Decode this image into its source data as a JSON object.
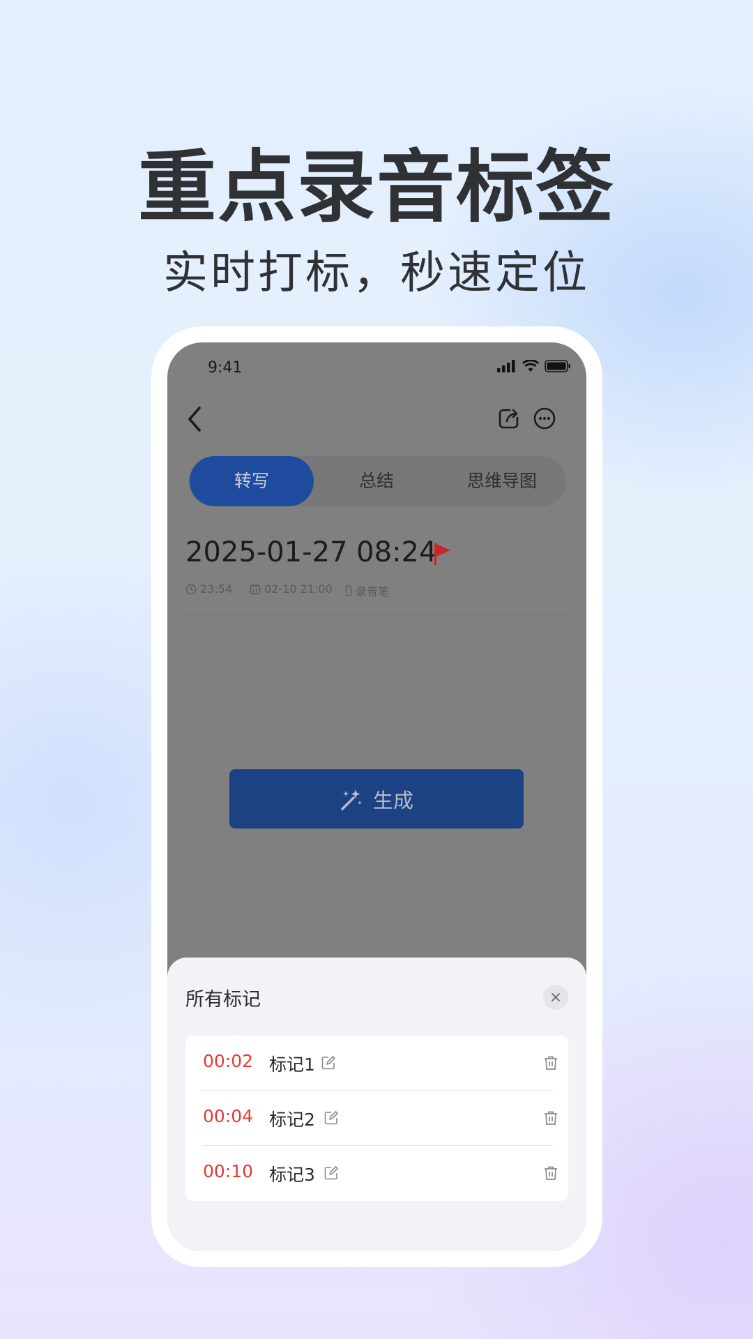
{
  "hero": {
    "title": "重点录音标签",
    "subtitle": "实时打标，秒速定位"
  },
  "status_bar": {
    "time": "9:41",
    "icons": [
      "signal-icon",
      "wifi-icon",
      "battery-icon"
    ]
  },
  "nav": {
    "icons": [
      "back-icon",
      "share-icon",
      "more-icon"
    ]
  },
  "tabs": [
    {
      "label": "转写",
      "active": true
    },
    {
      "label": "总结",
      "active": false
    },
    {
      "label": "思维导图",
      "active": false
    }
  ],
  "recording": {
    "title": "2025-01-27 08:24",
    "flag_color": "#e53935",
    "duration": "23:54",
    "date": "02-10 21:00",
    "device": "录音笔"
  },
  "generate_button": {
    "label": "生成",
    "icon": "magic-wand-icon"
  },
  "marks_sheet": {
    "title": "所有标记",
    "close_icon": "close-icon",
    "items": [
      {
        "time": "00:02",
        "name": "标记1"
      },
      {
        "time": "00:04",
        "name": "标记2"
      },
      {
        "time": "00:10",
        "name": "标记3"
      }
    ]
  },
  "colors": {
    "accent_blue": "#1e4b9e",
    "mark_time_red": "#e53935",
    "overlay_gray": "#808080"
  }
}
